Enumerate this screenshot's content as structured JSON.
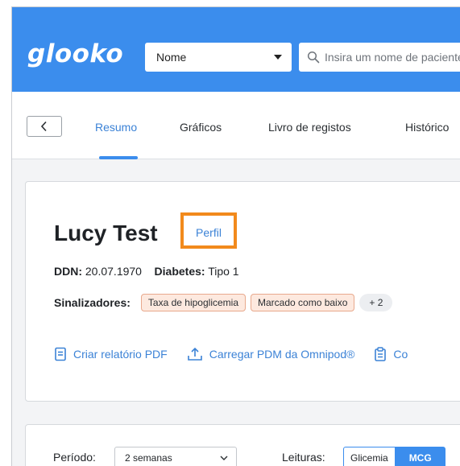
{
  "header": {
    "logo": "glooko",
    "search_type": {
      "selected": "Nome"
    },
    "search": {
      "placeholder": "Insira um nome de paciente"
    }
  },
  "tabs": [
    {
      "label": "Resumo",
      "active": true
    },
    {
      "label": "Gráficos",
      "active": false
    },
    {
      "label": "Livro de registos",
      "active": false
    },
    {
      "label": "Histórico",
      "active": false
    }
  ],
  "patient": {
    "name": "Lucy Test",
    "profile_link": "Perfil",
    "dob_label": "DDN:",
    "dob_value": "20.07.1970",
    "diabetes_label": "Diabetes:",
    "diabetes_value": "Tipo 1",
    "flags_label": "Sinalizadores:",
    "flags": [
      "Taxa de hipoglicemia",
      "Marcado como baixo"
    ],
    "flags_more": "+ 2"
  },
  "actions": [
    {
      "label": "Criar relatório PDF",
      "icon": "document-icon"
    },
    {
      "label": "Carregar PDM da Omnipod®",
      "icon": "upload-icon"
    },
    {
      "label": "Co",
      "icon": "clipboard-icon"
    }
  ],
  "filters": {
    "period_label": "Período:",
    "period_value": "2 semanas",
    "readings_label": "Leituras:",
    "readings_options": [
      "Glicemia",
      "MCG"
    ],
    "readings_selected": "MCG"
  },
  "colors": {
    "header_bg": "#3b8ded",
    "accent": "#3b82d6",
    "highlight_box": "#f28a1c",
    "flag_bg": "#fde9df"
  }
}
